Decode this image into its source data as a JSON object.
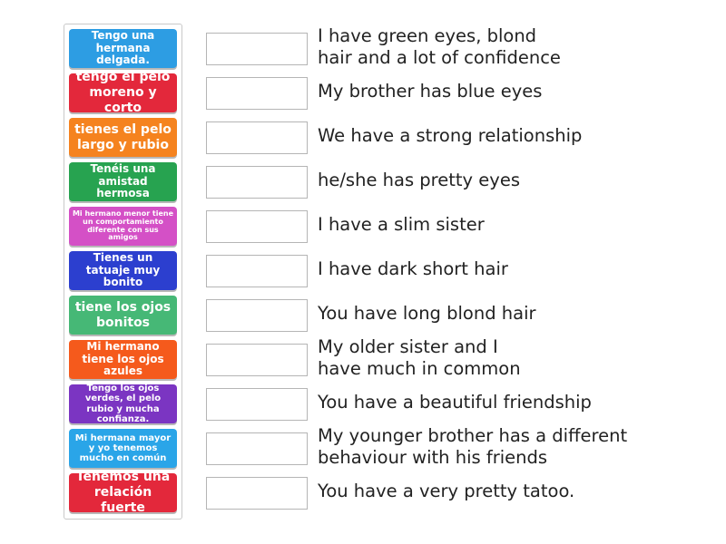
{
  "tiles": [
    {
      "label": "Tengo una hermana delgada.",
      "color": "#2d9de3"
    },
    {
      "label": "tengo el pelo moreno y corto",
      "color": "#e3283b"
    },
    {
      "label": "tienes el pelo largo y rubio",
      "color": "#f5831f"
    },
    {
      "label": "Tenéis una amistad hermosa",
      "color": "#27a350"
    },
    {
      "label": "Mi hermano menor tiene un comportamiento diferente con sus amigos",
      "color": "#d450c6"
    },
    {
      "label": "Tienes un tatuaje muy bonito",
      "color": "#2c3fcf"
    },
    {
      "label": "tiene los ojos bonitos",
      "color": "#46b876"
    },
    {
      "label": "Mi hermano tiene los ojos azules",
      "color": "#f55a1c"
    },
    {
      "label": "Tengo los ojos verdes, el pelo rubio y mucha confianza.",
      "color": "#7b35c2"
    },
    {
      "label": "Mi hermana mayor y yo tenemos mucho en común",
      "color": "#2aa5e8"
    },
    {
      "label": "Tenemos una relación fuerte",
      "color": "#e3283b"
    }
  ],
  "sentences": [
    "I have green eyes, blond\nhair and a lot of confidence",
    "My brother has blue eyes",
    "We have a strong relationship",
    "he/she has pretty eyes",
    "I have a slim sister",
    "I have dark short hair",
    "You have long blond hair",
    "My older sister and I\nhave much in common",
    "You have a beautiful friendship",
    "My younger brother has a different\nbehaviour with his friends",
    "You have a very pretty tatoo."
  ]
}
